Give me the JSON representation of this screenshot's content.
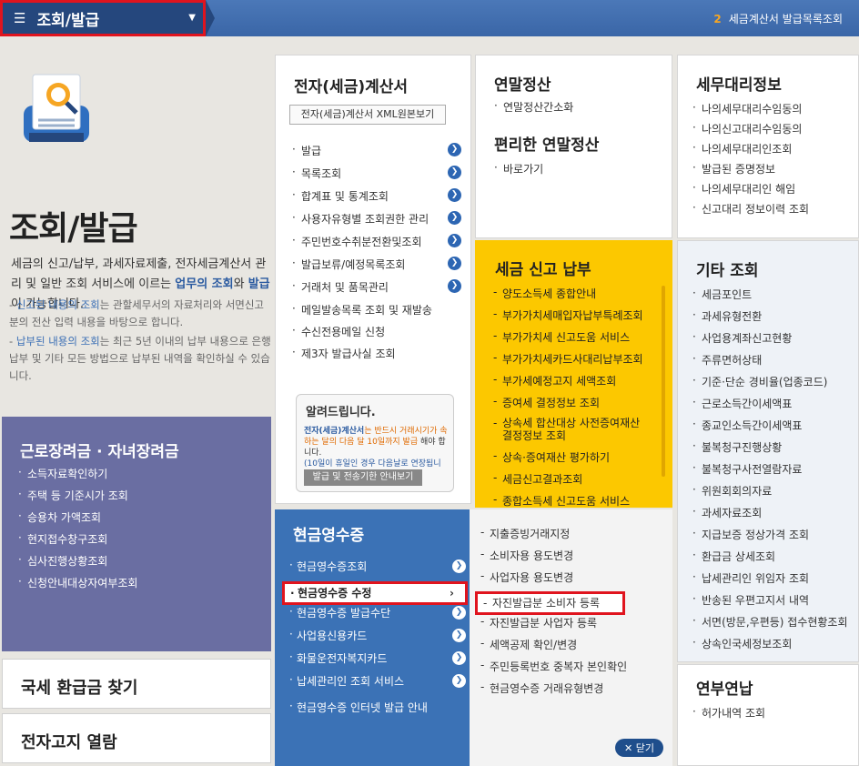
{
  "topbar": {
    "menu_label": "조회/발급",
    "crumb_num": "2",
    "crumb_text": "세금계산서 발급목록조회"
  },
  "hero": {
    "title": "조회/발급",
    "desc_pre": "세금의 신고/납부, 과세자료제출, 전자세금계산서 관리 및 일반 조회 서비스에 이르는 ",
    "desc_b1": "업무의 조회",
    "desc_mid": "와 ",
    "desc_b2": "발급",
    "desc_post": "이 가능합니다.",
    "note1_b": "신고된 내용의 조회",
    "note1": "는 관할세무서의 자료처리와 서면신고분의 전산 입력 내용을 바탕으로 합니다.",
    "note2_b": "납부된 내용의 조회",
    "note2": "는 최근 5년 이내의 납부 내용으로 은행 납부 및 기타 모든 방법으로 납부된 내역을 확인하실 수 있습니다."
  },
  "einvoice": {
    "title": "전자(세금)계산서",
    "xml_btn": "전자(세금)계산서 XML원본보기",
    "items": [
      "발급",
      "목록조회",
      "합계표 및 통계조회",
      "사용자유형별 조회권한 관리",
      "주민번호수취분전환및조회",
      "발급보류/예정목록조회",
      "거래처 및 품목관리",
      "메일발송목록 조회 및 재발송",
      "수신전용메일 신청",
      "제3자 발급사실 조회"
    ],
    "notice_title": "알려드립니다.",
    "notice_b": "전자(세금)계산서",
    "notice_t1": "는 반드시 거래시기가 속하는 달의 다음 달 10일까지 발급",
    "notice_t2": "해야 합니다.",
    "notice_small": "(10일이 휴일인 경우 다음날로 연장됩니다.)",
    "notice_btn": "발급 및 전송기한 안내보기"
  },
  "yearend": {
    "title": "연말정산",
    "items": [
      "연말정산간소화"
    ],
    "title2": "편리한 연말정산",
    "items2": [
      "바로가기"
    ]
  },
  "taxagent": {
    "title": "세무대리정보",
    "items": [
      "나의세무대리수임동의",
      "나의신고대리수임동의",
      "나의세무대리인조회",
      "발급된 증명정보",
      "나의세무대리인 해임",
      "신고대리 정보이력 조회"
    ]
  },
  "taxreport": {
    "title": "세금 신고 납부",
    "items": [
      "양도소득세 종합안내",
      "부가가치세매입자납부특례조회",
      "부가가치세 신고도움 서비스",
      "부가가치세카드사대리납부조회",
      "부가세예정고지 세액조회",
      "증여세 결정정보 조회",
      "상속세 합산대상 사전증여재산",
      "결정정보 조회",
      "상속·증여재산 평가하기",
      "세금신고결과조회",
      "종합소득세 신고도움 서비스"
    ]
  },
  "other": {
    "title": "기타 조회",
    "items": [
      "세금포인트",
      "과세유형전환",
      "사업용계좌신고현황",
      "주류면허상태",
      "기준·단순 경비율(업종코드)",
      "근로소득간이세액표",
      "종교인소득간이세액표",
      "불복청구진행상황",
      "불복청구사전열람자료",
      "위원회회의자료",
      "과세자료조회",
      "지급보증 정상가격 조회",
      "환급금 상세조회",
      "납세관리인 위임자 조회",
      "반송된 우편고지서 내역",
      "서면(방문,우편등) 접수현황조회",
      "상속인국세정보조회"
    ]
  },
  "yearly": {
    "title": "연부연납",
    "items": [
      "허가내역 조회"
    ]
  },
  "worker": {
    "title": "근로장려금 · 자녀장려금",
    "items": [
      "소득자료확인하기",
      "주택 등 기준시가 조회",
      "승용차 가액조회",
      "현지접수창구조회",
      "심사진행상황조회",
      "신청안내대상자여부조회"
    ]
  },
  "cash": {
    "title": "현금영수증",
    "items": [
      "현금영수증조회",
      "현금영수증 수정",
      "현금영수증 발급수단",
      "사업용신용카드",
      "화물운전자복지카드",
      "납세관리인 조회 서비스",
      "현금영수증 인터넷 발급 안내"
    ],
    "sub": [
      "지출증빙거래지정",
      "소비자용 용도변경",
      "사업자용 용도변경",
      "자진발급분 소비자 등록",
      "자진발급분 사업자 등록",
      "세액공제 확인/변경",
      "주민등록번호 중복자 본인확인",
      "현금영수증 거래유형변경"
    ],
    "close": "닫기"
  },
  "refund": {
    "label": "국세 환급금 찾기"
  },
  "etax": {
    "label": "전자고지 열람"
  }
}
